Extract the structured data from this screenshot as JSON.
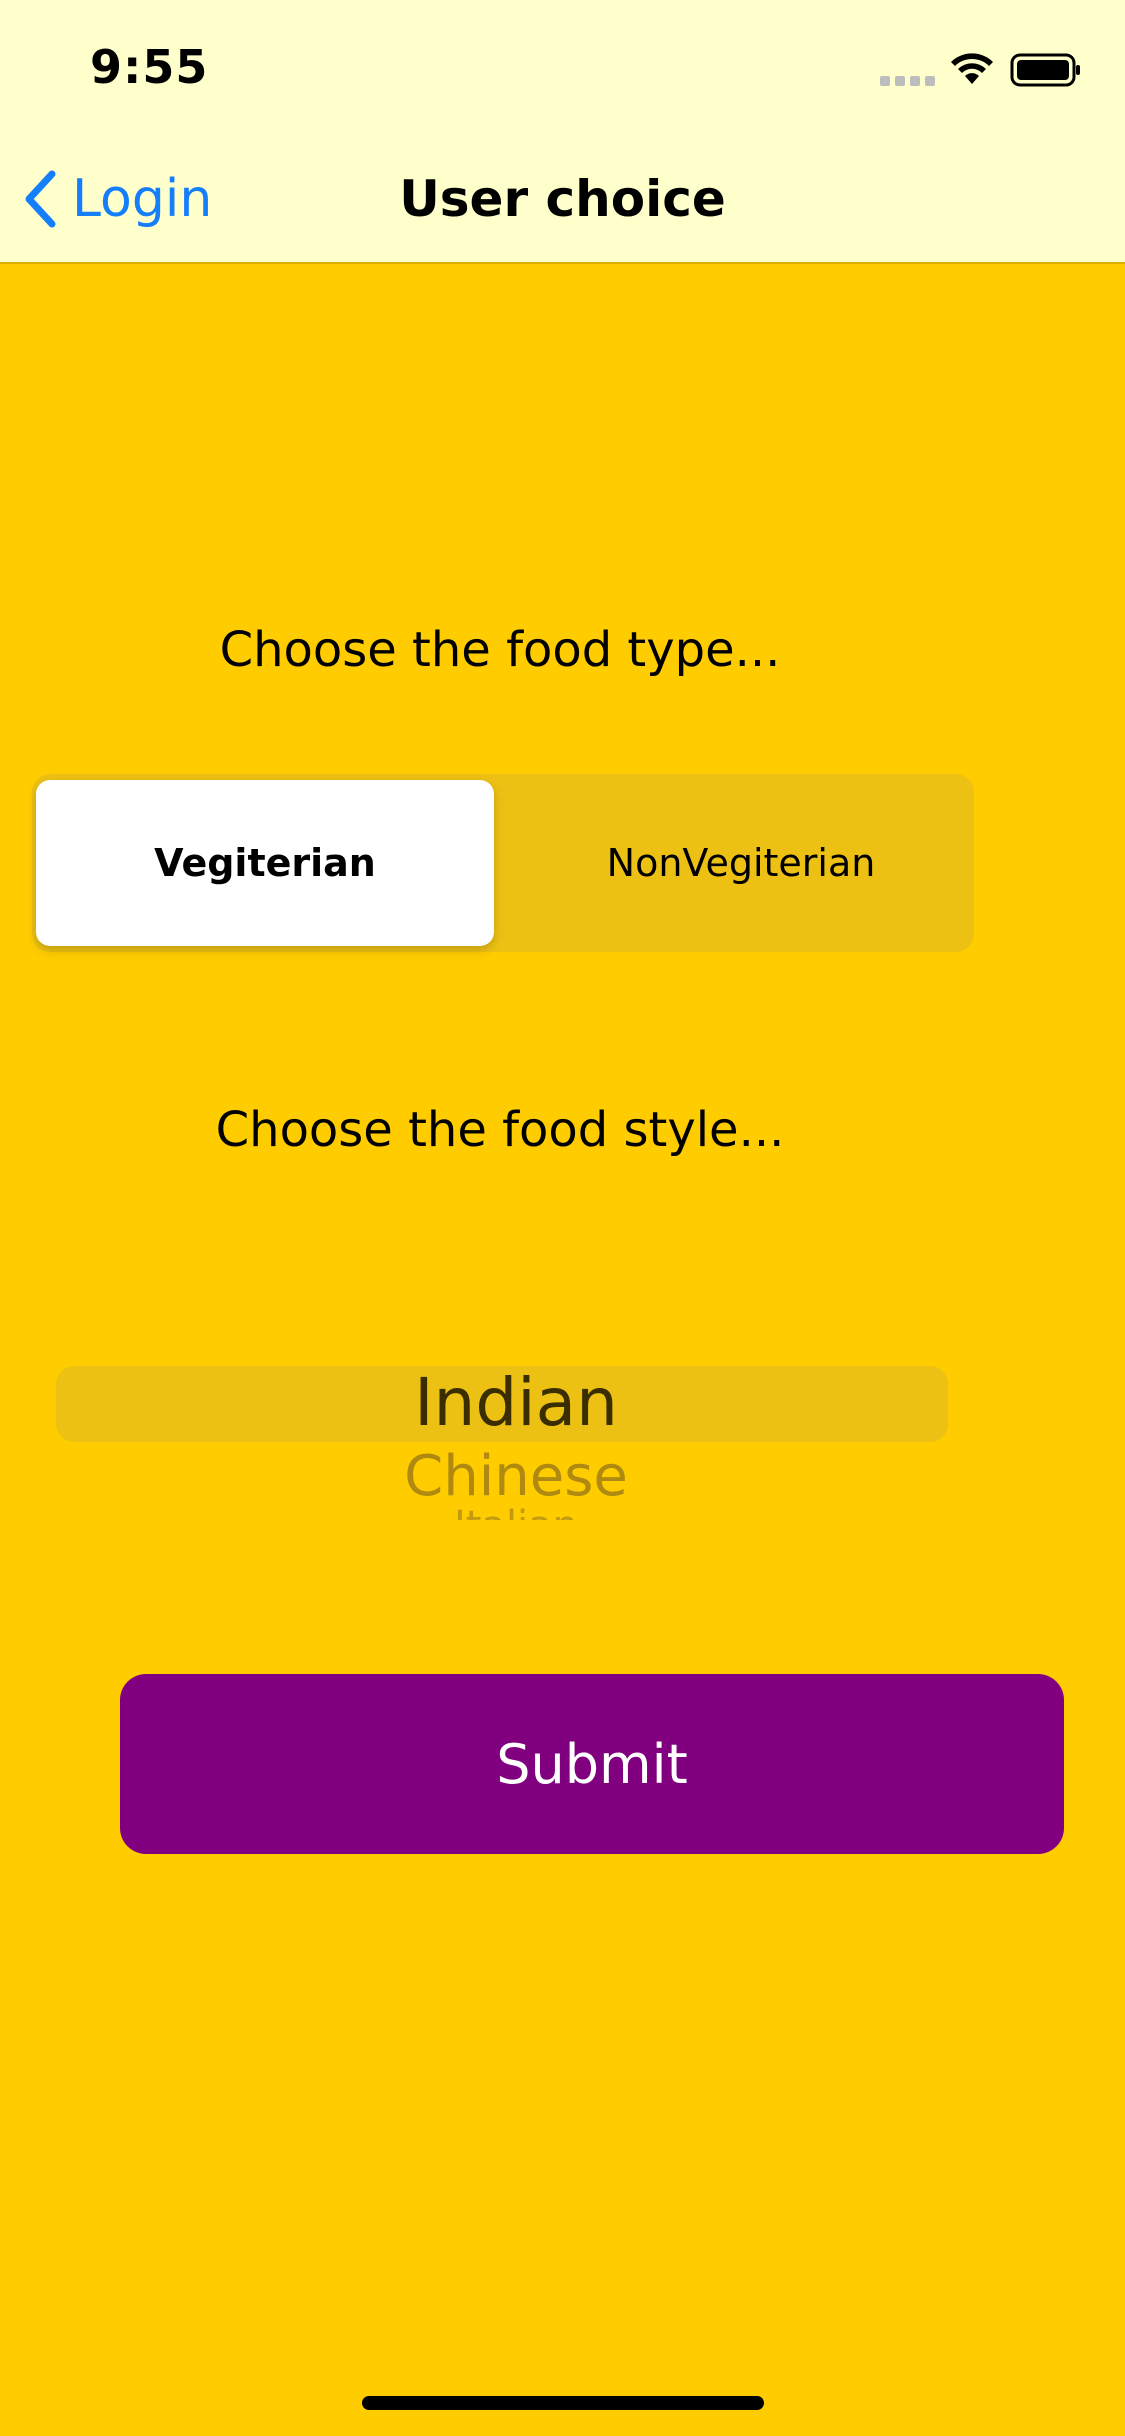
{
  "status_bar": {
    "time": "9:55"
  },
  "nav": {
    "back_label": "Login",
    "title": "User choice"
  },
  "food_type": {
    "prompt": "Choose the food type...",
    "options": [
      "Vegiterian",
      "NonVegiterian"
    ],
    "selected": "Vegiterian"
  },
  "food_style": {
    "prompt": "Choose the food style...",
    "picker_items": [
      "Indian",
      "Chinese",
      "Italian"
    ],
    "selected": "Indian"
  },
  "submit_label": "Submit",
  "colors": {
    "background": "#FFCC00",
    "nav_background": "#FFFFCC",
    "accent": "#147EFB",
    "submit_background": "#800080",
    "segment_track": "#EDC113"
  },
  "icons": {
    "back": "chevron-left-icon",
    "wifi": "wifi-icon",
    "battery": "battery-icon",
    "cellular": "cellular-signal-icon"
  }
}
